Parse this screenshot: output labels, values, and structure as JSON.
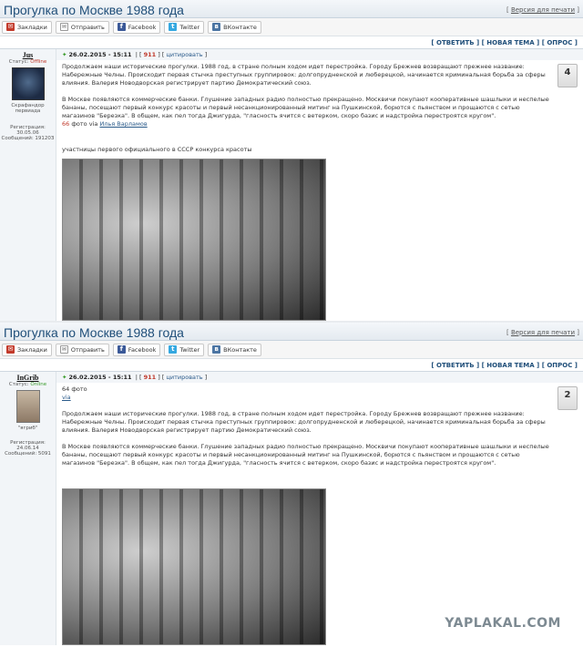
{
  "posts": [
    {
      "title": "Прогулка по Москве 1988 года",
      "print_prefix": "[",
      "print_link": "Версия для печати",
      "print_suffix": "]",
      "share": {
        "bookmark": "Закладки",
        "send": "Отправить",
        "facebook": "Facebook",
        "twitter": "Twitter",
        "vk": "ВКонтакте"
      },
      "actions": "[ ОТВЕТИТЬ ] [ НОВАЯ ТЕМА ] [ ОПРОС ]",
      "author": {
        "name": "Jus",
        "status_label": "Статус:",
        "status": "Offline",
        "role": "Скрафандор первиада",
        "registration": "Регистрация: 30.05.06",
        "messages": "Сообщений: 19120З"
      },
      "meta": {
        "date": "26.02.2015 - 15:11",
        "count": "911",
        "quote": "цитировать"
      },
      "rating": "4",
      "paragraphs": [
        "Продолжаем наши исторические прогулки. 1988 год, в стране полным ходом идет перестройка. Городу Брежнев возвращают прежнее название: Набережные Челны. Происходит первая стычка преступных группировок: долгопрудненской и люберецкой, начинается криминальная борьба за сферы влияния. Валерия Новодворская регистрирует партию Демократический союз.",
        "В Москве появляются коммерческие банки. Глушение западных радио полностью прекращено. Москвичи покупают кооперативные шашлыки и неспелые бананы, посещают первый конкурс красоты и первый несанкционированный митинг на Пушкинской, борются с пьянством и прощаются с сетью магазинов \"Березка\". В общем, как пел тогда Джигурда, \"гласность ячится с ветерком, скоро базис и надстройка перестроятся кругом\"."
      ],
      "photo_count": "66",
      "photo_word": "фото via",
      "photo_author": "Илья Варламов",
      "caption": "участницы первого официального в СССР конкурса красоты"
    },
    {
      "title": "Прогулка по Москве 1988 года",
      "print_prefix": "[",
      "print_link": "Версия для печати",
      "print_suffix": "]",
      "share": {
        "bookmark": "Закладки",
        "send": "Отправить",
        "facebook": "Facebook",
        "twitter": "Twitter",
        "vk": "ВКонтакте"
      },
      "actions": "[ ОТВЕТИТЬ ] [ НОВАЯ ТЕМА ] [ ОПРОС ]",
      "author": {
        "name": "InGrib",
        "status_label": "Статус:",
        "status": "Online",
        "nick": "\"ягриб\"",
        "registration": "Регистрация: 24.06.14",
        "messages": "Сообщений: 5091"
      },
      "meta": {
        "date": "26.02.2015 - 15:11",
        "count": "911",
        "quote": "цитировать"
      },
      "rating": "2",
      "top_line1": "64 фото",
      "top_line2": "via",
      "paragraphs": [
        "Продолжаем наши исторические прогулки. 1988 год, в стране полным ходом идет перестройка. Городу Брежнев возвращают прежнее название: Набережные Челны. Происходит первая стычка преступных группировок: долгопрудненской и люберецкой, начинается криминальная борьба за сферы влияния. Валерия Новодворская регистрирует партию Демократический союз.",
        "В Москве появляются коммерческие банки. Глушение западных радио полностью прекращено. Москвичи покупают кооперативные шашлыки и неспелые бананы, посещают первый конкурс красоты и первый несанкционированный митинг на Пушкинской, борются с пьянством и прощаются с сетью магазинов \"Березка\". В общем, как пел тогда Джигурда, \"гласность ячится с ветерком, скоро базис и надстройка перестроятся кругом\"."
      ]
    }
  ],
  "watermark": "YAPLAKAL.COM"
}
